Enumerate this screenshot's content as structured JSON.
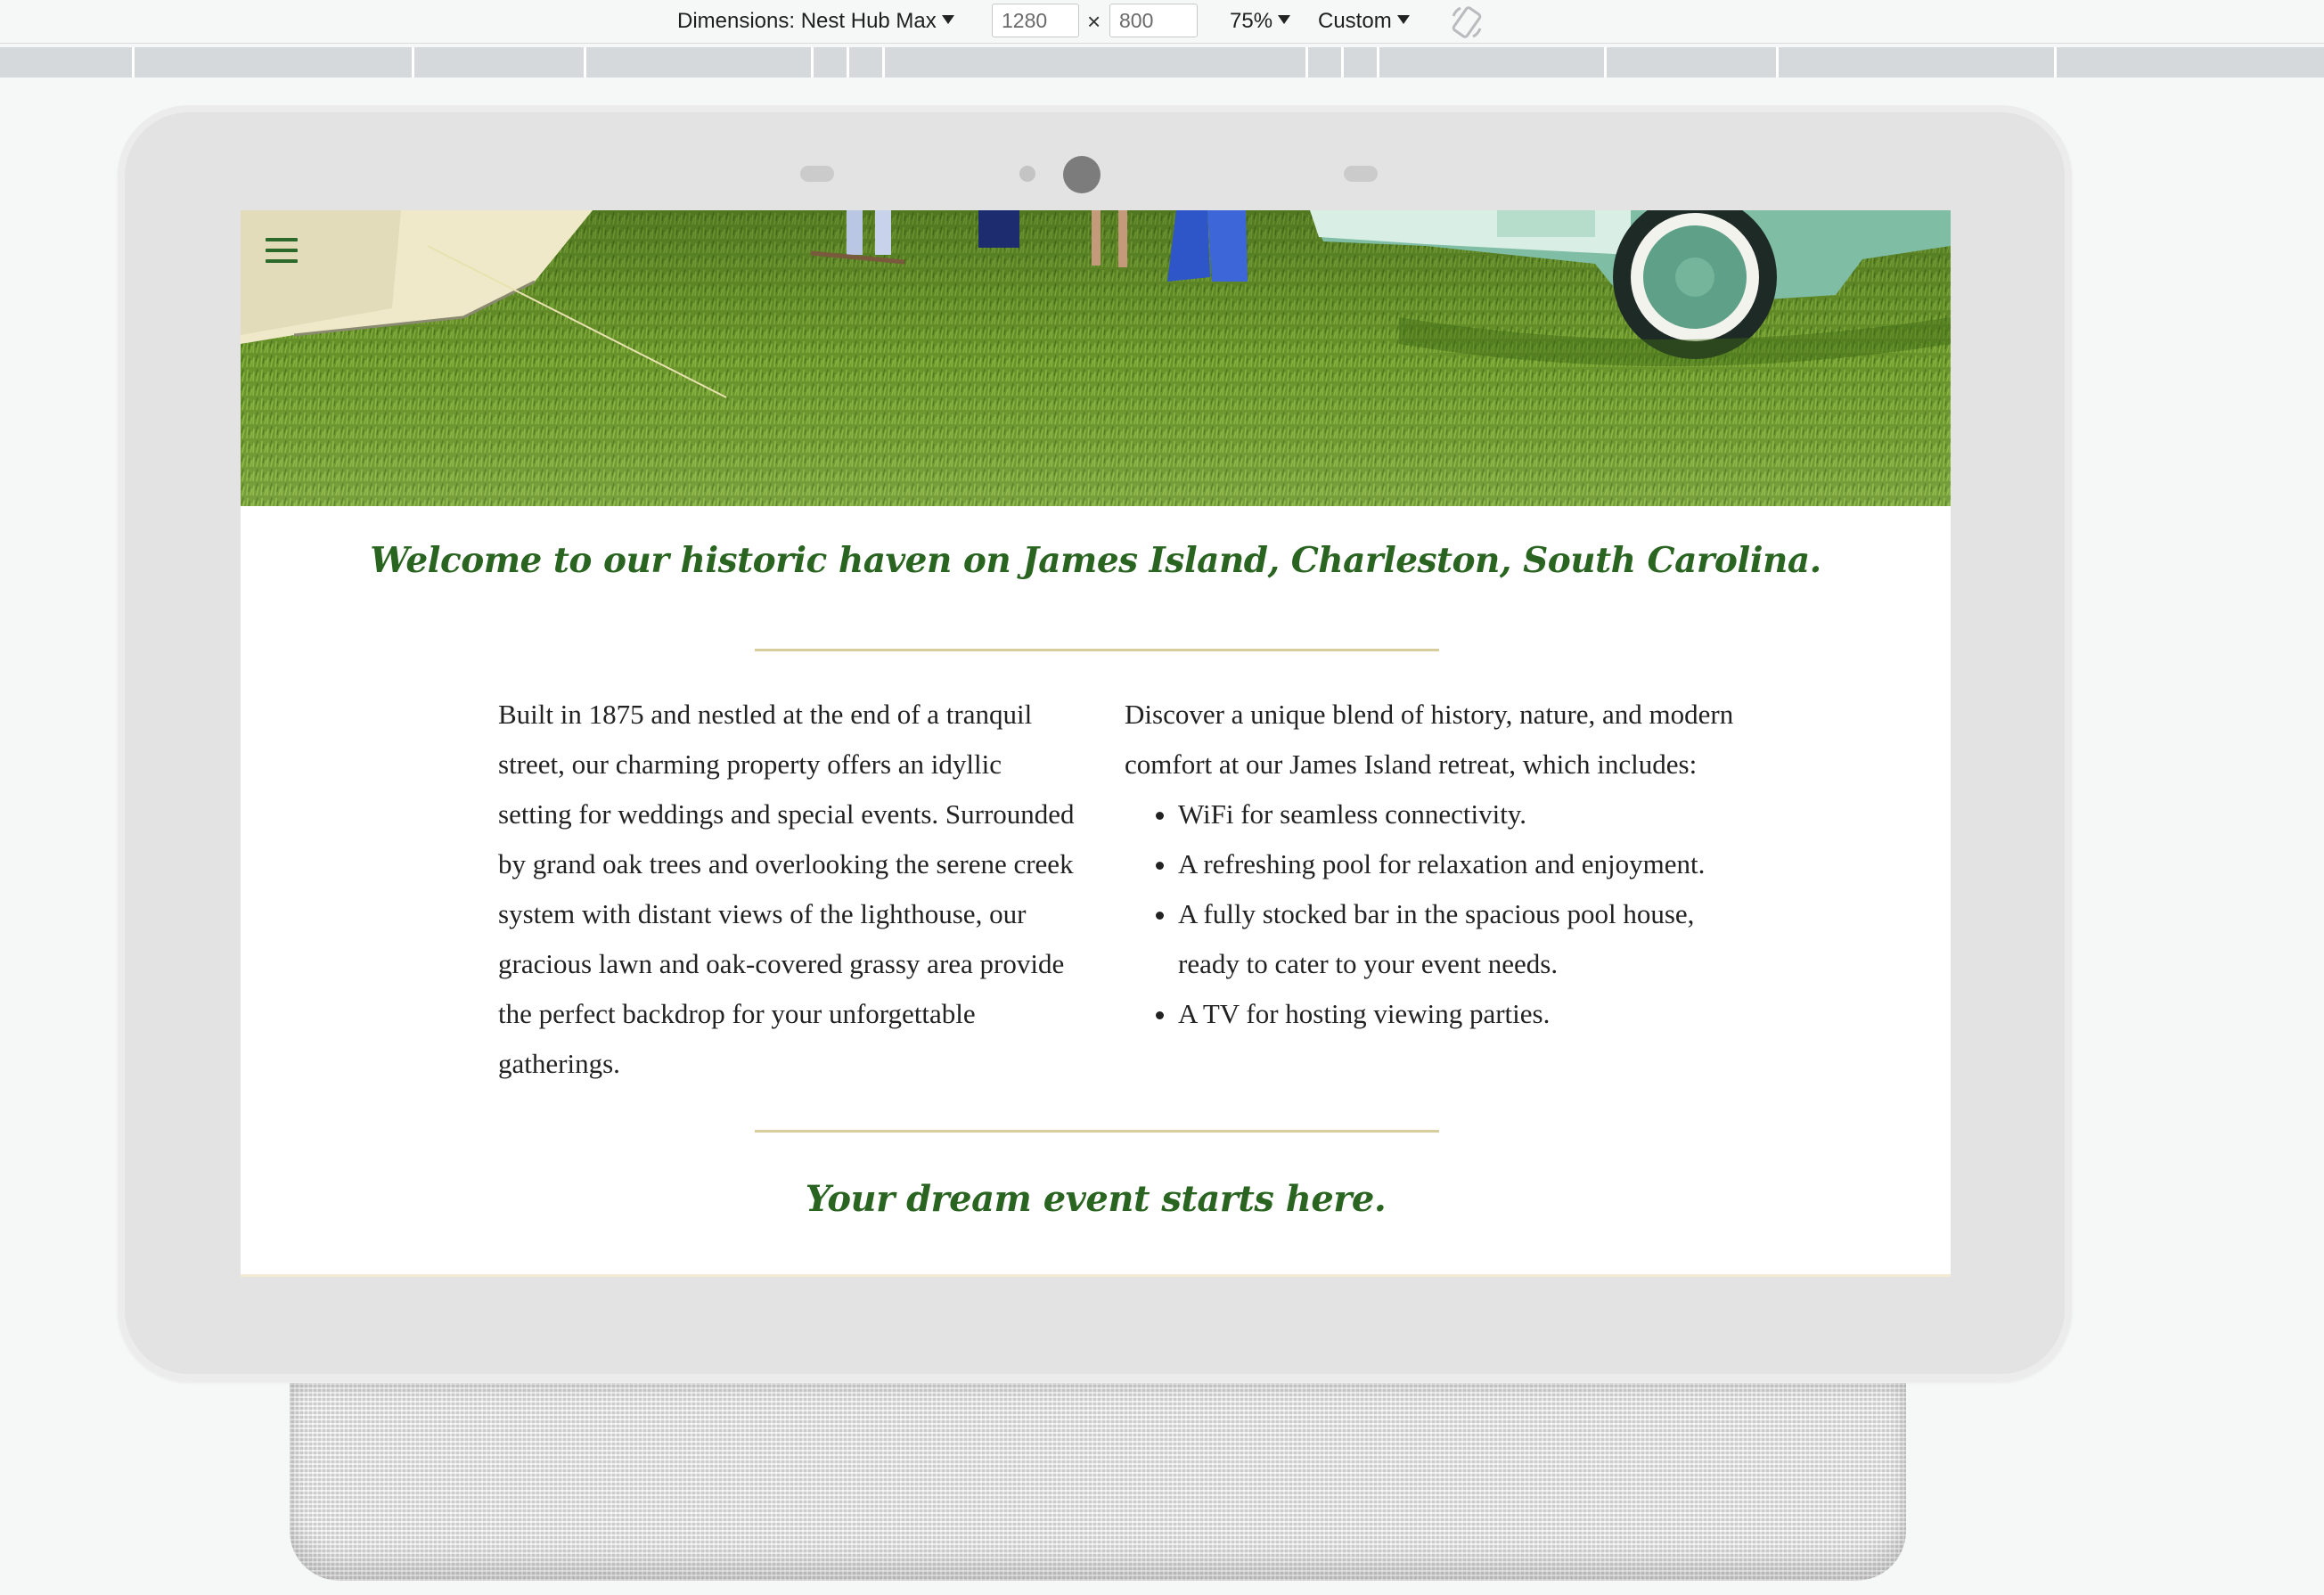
{
  "toolbar": {
    "device_label": "Dimensions: Nest Hub Max",
    "width_value": "1280",
    "times": "×",
    "height_value": "800",
    "zoom_label": "75%",
    "throttle_label": "Custom",
    "rotate_icon": "rotate-icon"
  },
  "device": {
    "frame_color": "#e3e3e3"
  },
  "page": {
    "menu_icon": "hamburger-menu-icon",
    "heading": "Welcome to our historic haven on James Island, Charleston, South Carolina.",
    "left_paragraph": "Built in 1875 and nestled at the end of a tranquil street, our charming property offers an idyllic setting for weddings and special events. Surrounded by grand oak trees and overlooking the serene creek system with distant views of the lighthouse, our gracious lawn and oak-covered grassy area provide the perfect backdrop for your unforgettable gatherings.",
    "right_intro": "Discover a unique blend of history, nature, and modern comfort at our James Island retreat, which includes:",
    "amenities": [
      "WiFi for seamless connectivity.",
      "A refreshing pool for relaxation and enjoyment.",
      "A fully stocked bar in the spacious pool house, ready to cater to your event needs.",
      "A TV for hosting viewing parties."
    ],
    "tagline": "Your dream event starts here.",
    "accent_color": "#2a6421",
    "rule_color": "#d8cd9c"
  }
}
